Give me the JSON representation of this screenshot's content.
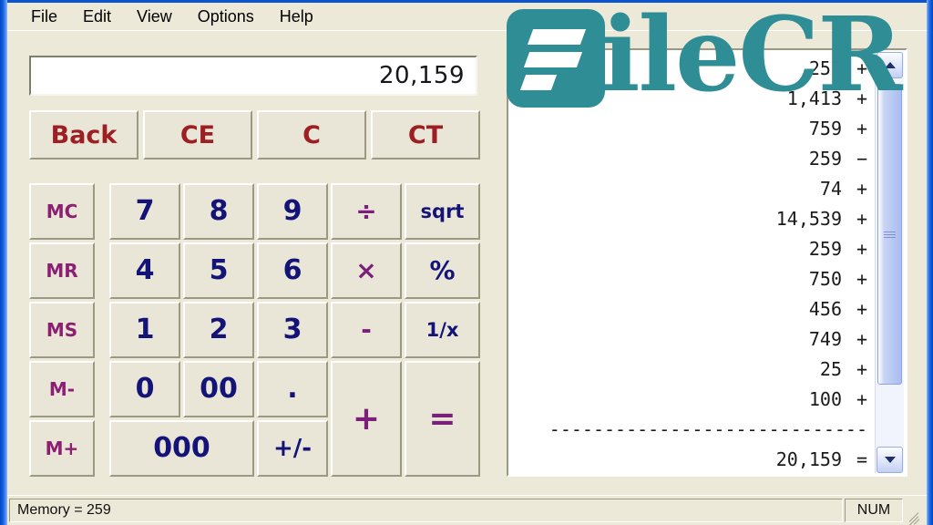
{
  "window": {
    "accent_border_color": "#0a55cf",
    "face_color": "#ece9d8"
  },
  "menubar": {
    "items": [
      {
        "label": "File"
      },
      {
        "label": "Edit"
      },
      {
        "label": "View"
      },
      {
        "label": "Options"
      },
      {
        "label": "Help"
      }
    ]
  },
  "display": {
    "value": "20,159"
  },
  "keypad": {
    "function_row": [
      {
        "label": "Back",
        "name": "backspace-button"
      },
      {
        "label": "CE",
        "name": "clear-entry-button"
      },
      {
        "label": "C",
        "name": "clear-button"
      },
      {
        "label": "CT",
        "name": "clear-tape-button"
      }
    ],
    "memory": [
      {
        "label": "MC",
        "name": "memory-clear-button"
      },
      {
        "label": "MR",
        "name": "memory-recall-button"
      },
      {
        "label": "MS",
        "name": "memory-store-button"
      },
      {
        "label": "M-",
        "name": "memory-subtract-button"
      },
      {
        "label": "M+",
        "name": "memory-add-button"
      }
    ],
    "digits": {
      "d7": "7",
      "d8": "8",
      "d9": "9",
      "d4": "4",
      "d5": "5",
      "d6": "6",
      "d1": "1",
      "d2": "2",
      "d3": "3",
      "d0": "0",
      "d00": "00",
      "d000": "000",
      "dot": ".",
      "sign": "+/-"
    },
    "operators": {
      "divide": "÷",
      "multiply": "×",
      "minus": "-",
      "plus": "+",
      "equals": "=",
      "sqrt": "sqrt",
      "percent": "%",
      "reciprocal": "1/x"
    }
  },
  "tape": {
    "rows": [
      {
        "value": "257",
        "op": "+"
      },
      {
        "value": "1,413",
        "op": "+"
      },
      {
        "value": "759",
        "op": "+"
      },
      {
        "value": "259",
        "op": "−"
      },
      {
        "value": "74",
        "op": "+"
      },
      {
        "value": "14,539",
        "op": "+"
      },
      {
        "value": "259",
        "op": "+"
      },
      {
        "value": "750",
        "op": "+"
      },
      {
        "value": "456",
        "op": "+"
      },
      {
        "value": "749",
        "op": "+"
      },
      {
        "value": "25",
        "op": "+"
      },
      {
        "value": "100",
        "op": "+"
      }
    ],
    "separator": "-----------------------------",
    "total": {
      "value": "20,159",
      "op": "="
    }
  },
  "scrollbar": {
    "up_arrow": "scroll-up",
    "down_arrow": "scroll-down"
  },
  "statusbar": {
    "memory_text": "Memory = 259",
    "num_lock": "NUM"
  },
  "watermark": {
    "text": "ileCR",
    "color": "#2f8d95"
  }
}
